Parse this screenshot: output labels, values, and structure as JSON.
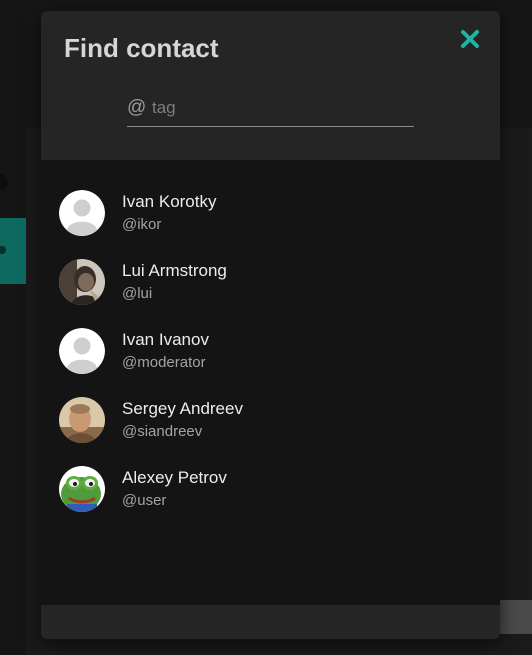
{
  "modal": {
    "title": "Find contact",
    "close_icon": "close-icon",
    "accent_color": "#1fb5a2"
  },
  "search": {
    "at_symbol": "@",
    "placeholder": "tag",
    "value": ""
  },
  "contacts": [
    {
      "name": "Ivan Korotky",
      "tag": "@ikor",
      "avatar": "default-avatar"
    },
    {
      "name": "Lui Armstrong",
      "tag": "@lui",
      "avatar": "photo-avatar"
    },
    {
      "name": "Ivan Ivanov",
      "tag": "@moderator",
      "avatar": "default-avatar"
    },
    {
      "name": "Sergey Andreev",
      "tag": "@siandreev",
      "avatar": "photo-avatar"
    },
    {
      "name": "Alexey Petrov",
      "tag": "@user",
      "avatar": "frog-avatar"
    }
  ]
}
